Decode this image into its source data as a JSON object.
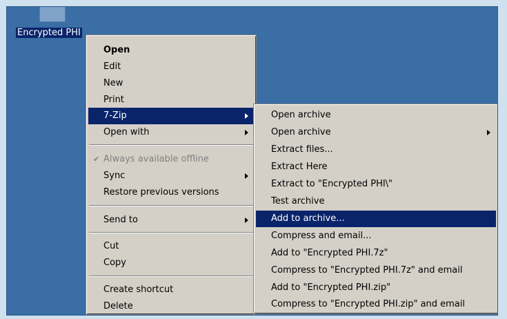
{
  "desktop": {
    "icon_label": "Encrypted PHI"
  },
  "context_menu": {
    "items": [
      {
        "label": "Open"
      },
      {
        "label": "Edit"
      },
      {
        "label": "New"
      },
      {
        "label": "Print"
      },
      {
        "label": "7-Zip"
      },
      {
        "label": "Open with"
      },
      {
        "label": "Always available offline"
      },
      {
        "label": "Sync"
      },
      {
        "label": "Restore previous versions"
      },
      {
        "label": "Send to"
      },
      {
        "label": "Cut"
      },
      {
        "label": "Copy"
      },
      {
        "label": "Create shortcut"
      },
      {
        "label": "Delete"
      }
    ]
  },
  "submenu_7zip": {
    "items": [
      {
        "label": "Open archive"
      },
      {
        "label": "Open archive"
      },
      {
        "label": "Extract files..."
      },
      {
        "label": "Extract Here"
      },
      {
        "label": "Extract to \"Encrypted PHI\\\""
      },
      {
        "label": "Test archive"
      },
      {
        "label": "Add to archive..."
      },
      {
        "label": "Compress and email..."
      },
      {
        "label": "Add to \"Encrypted PHI.7z\""
      },
      {
        "label": "Compress to \"Encrypted PHI.7z\" and email"
      },
      {
        "label": "Add to \"Encrypted PHI.zip\""
      },
      {
        "label": "Compress to \"Encrypted PHI.zip\" and email"
      }
    ]
  },
  "colors": {
    "desktop": "#3a6ea5",
    "menu": "#d4d0c8",
    "highlight": "#0a246a",
    "frame": "#cfe1ef"
  }
}
